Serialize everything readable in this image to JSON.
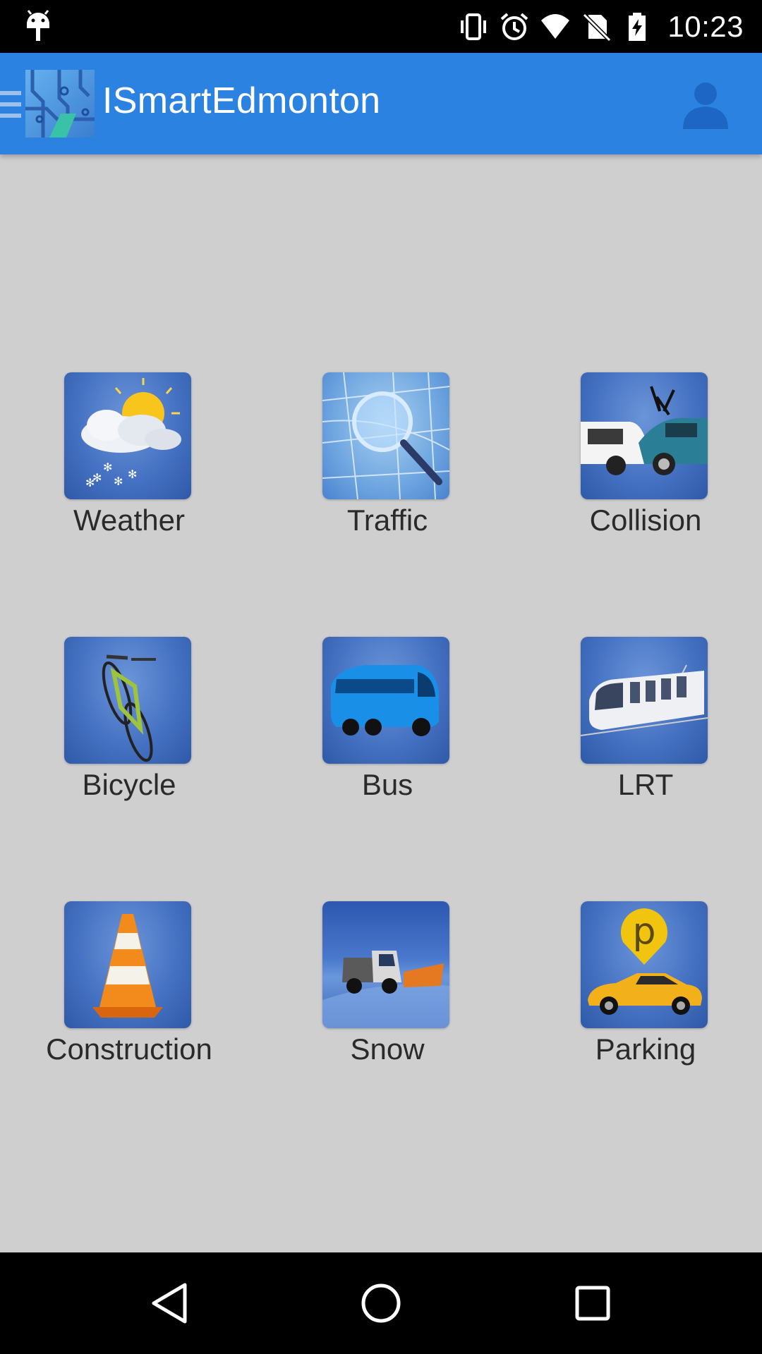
{
  "status_bar": {
    "time": "10:23",
    "icons": [
      "android-debug-icon",
      "vibrate-icon",
      "alarm-icon",
      "wifi-icon",
      "no-sim-icon",
      "battery-icon"
    ]
  },
  "app_bar": {
    "title": "ISmartEdmonton",
    "icons": [
      "menu-icon",
      "app-logo-icon",
      "account-icon"
    ]
  },
  "tiles": [
    {
      "label": "Weather",
      "icon": "weather-icon"
    },
    {
      "label": "Traffic",
      "icon": "traffic-icon"
    },
    {
      "label": "Collision",
      "icon": "collision-icon"
    },
    {
      "label": "Bicycle",
      "icon": "bicycle-icon"
    },
    {
      "label": "Bus",
      "icon": "bus-icon"
    },
    {
      "label": "LRT",
      "icon": "lrt-icon"
    },
    {
      "label": "Construction",
      "icon": "construction-cone-icon"
    },
    {
      "label": "Snow",
      "icon": "snow-plow-icon"
    },
    {
      "label": "Parking",
      "icon": "parking-icon"
    }
  ],
  "nav_bar": {
    "buttons": [
      "back-icon",
      "home-icon",
      "recents-icon"
    ]
  },
  "colors": {
    "app_bar": "#2b82e0",
    "background": "#cfcfcf",
    "tile_blue": "#4672c3"
  }
}
